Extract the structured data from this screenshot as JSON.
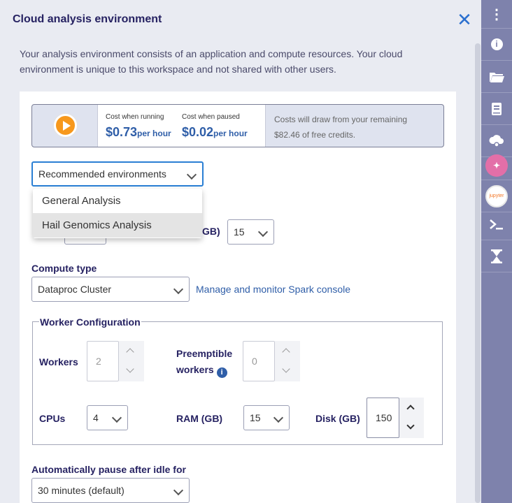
{
  "header": {
    "title": "Cloud analysis environment",
    "intro": "Your analysis environment consists of an application and compute resources. Your cloud environment is unique to this workspace and not shared with other users."
  },
  "cost": {
    "running_label": "Cost when running",
    "running_value": "$0.73",
    "paused_label": "Cost when paused",
    "paused_value": "$0.02",
    "per_hour": "per hour",
    "credits_text": "Costs will draw from your remaining $82.46 of free credits."
  },
  "environment_select": {
    "value": "Recommended environments",
    "options": [
      "General Analysis",
      "Hail Genomics Analysis"
    ],
    "hovered_option": "Hail Genomics Analysis"
  },
  "partially_hidden": {
    "gb_label": "GB)",
    "disk_value": "15"
  },
  "compute": {
    "label": "Compute type",
    "value": "Dataproc Cluster",
    "link": "Manage and monitor Spark console"
  },
  "worker_config": {
    "legend": "Worker Configuration",
    "workers_label": "Workers",
    "workers_value": "2",
    "preemptible_label_1": "Preemptible",
    "preemptible_label_2": "workers",
    "preemptible_value": "0",
    "cpus_label": "CPUs",
    "cpus_value": "4",
    "ram_label": "RAM (GB)",
    "ram_value": "15",
    "disk_label": "Disk (GB)",
    "disk_value": "150"
  },
  "autopause": {
    "label": "Automatically pause after idle for",
    "value": "30 minutes (default)"
  },
  "sidebar": {
    "items": [
      "more-menu",
      "info",
      "folder",
      "notebook",
      "cloud-environment",
      "galaxy",
      "jupyter",
      "terminal",
      "hourglass"
    ]
  },
  "colors": {
    "brand_dark": "#262262",
    "accent_blue": "#2f5ea8",
    "play_orange": "#f7981c",
    "sidebar_bg": "#7e82ac"
  }
}
